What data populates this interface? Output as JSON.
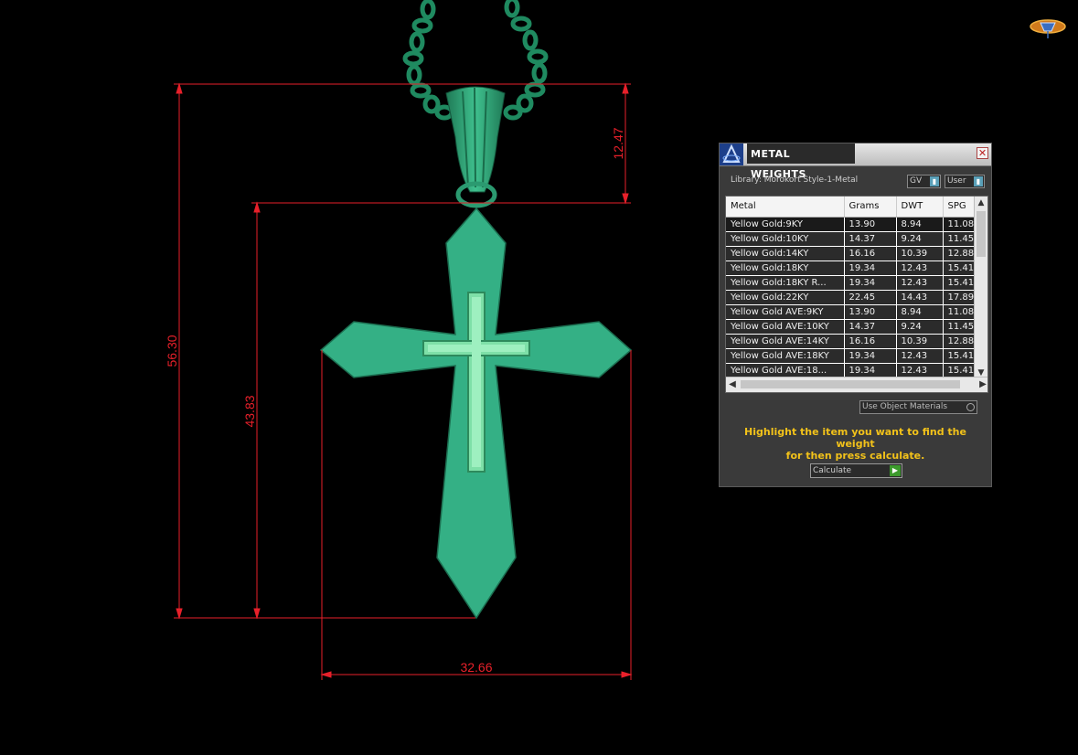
{
  "dimensions": {
    "overall_height": "56.30",
    "body_height": "43.83",
    "bail_height": "12.47",
    "width": "32.66"
  },
  "logo": {
    "icon": "gem-logo-icon"
  },
  "panel": {
    "title": "METAL WEIGHTS",
    "app_icon": "app-logo-icon",
    "close_icon": "close-icon",
    "close_glyph": "✕",
    "library_label": "Library: Morokort Style-1-Metal",
    "gv_select": "GV",
    "user_select": "User",
    "table": {
      "headers": [
        "Metal",
        "Grams",
        "DWT",
        "SPG"
      ],
      "rows": [
        [
          "Yellow Gold:9KY",
          "13.90",
          "8.94",
          "11.08"
        ],
        [
          "Yellow Gold:10KY",
          "14.37",
          "9.24",
          "11.45"
        ],
        [
          "Yellow Gold:14KY",
          "16.16",
          "10.39",
          "12.88"
        ],
        [
          "Yellow Gold:18KY",
          "19.34",
          "12.43",
          "15.41"
        ],
        [
          "Yellow Gold:18KY R...",
          "19.34",
          "12.43",
          "15.41"
        ],
        [
          "Yellow Gold:22KY",
          "22.45",
          "14.43",
          "17.89"
        ],
        [
          "Yellow Gold AVE:9KY",
          "13.90",
          "8.94",
          "11.08"
        ],
        [
          "Yellow Gold AVE:10KY",
          "14.37",
          "9.24",
          "11.45"
        ],
        [
          "Yellow Gold AVE:14KY",
          "16.16",
          "10.39",
          "12.88"
        ],
        [
          "Yellow Gold AVE:18KY",
          "19.34",
          "12.43",
          "15.41"
        ],
        [
          "Yellow Gold AVE:18...",
          "19.34",
          "12.43",
          "15.41"
        ]
      ]
    },
    "use_object_materials": "Use Object Materials",
    "hint_line1": "Highlight the item you want to find the weight",
    "hint_line2": "for then press calculate.",
    "calculate_label": "Calculate"
  },
  "colors": {
    "background": "#000000",
    "pendant": "#2fa67a",
    "dimension_lines": "#e8202a",
    "hint_text": "#f2c21a"
  }
}
